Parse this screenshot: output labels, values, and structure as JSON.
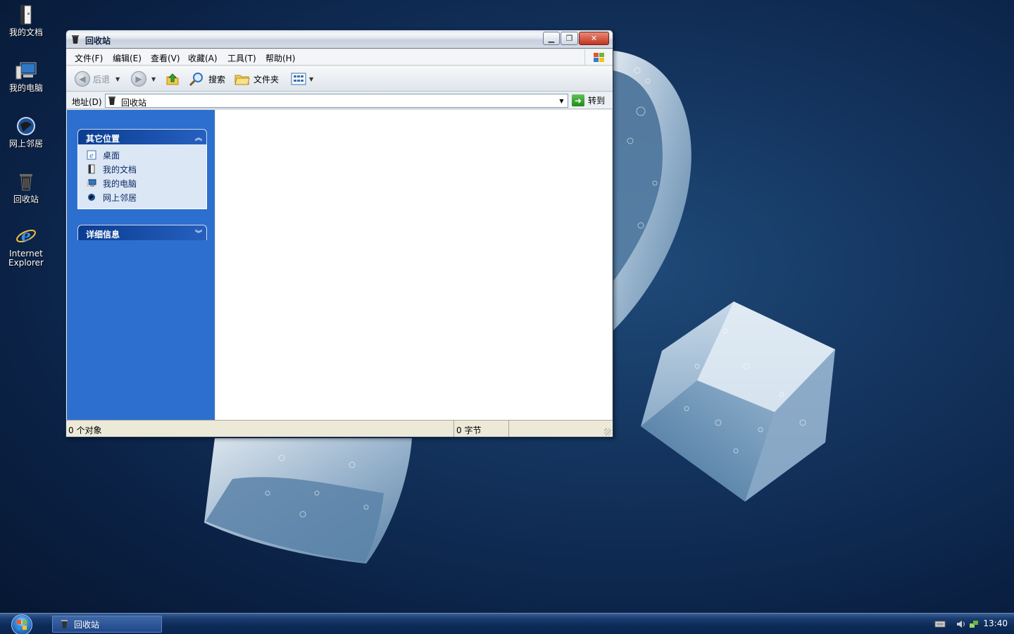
{
  "desktop": {
    "icons": [
      {
        "label": "我的文档",
        "icon": "my-documents-icon"
      },
      {
        "label": "我的电脑",
        "icon": "my-computer-icon"
      },
      {
        "label": "网上邻居",
        "icon": "network-places-icon"
      },
      {
        "label": "回收站",
        "icon": "recycle-bin-icon"
      },
      {
        "label_line1": "Internet",
        "label_line2": "Explorer",
        "icon": "internet-explorer-icon"
      }
    ]
  },
  "window": {
    "title": "回收站",
    "menu": [
      "文件(F)",
      "编辑(E)",
      "查看(V)",
      "收藏(A)",
      "工具(T)",
      "帮助(H)"
    ],
    "toolbar": {
      "back_label": "后退",
      "search_label": "搜索",
      "folders_label": "文件夹"
    },
    "address": {
      "label": "地址(D)",
      "value": "回收站",
      "go_label": "转到"
    },
    "panels": [
      {
        "title": "其它位置",
        "items": [
          {
            "label": "桌面",
            "icon": "desktop-icon"
          },
          {
            "label": "我的文档",
            "icon": "my-documents-icon"
          },
          {
            "label": "我的电脑",
            "icon": "my-computer-icon"
          },
          {
            "label": "网上邻居",
            "icon": "network-places-icon"
          }
        ]
      },
      {
        "title": "详细信息",
        "items": []
      }
    ],
    "status": {
      "objects": "0 个对象",
      "size": "0 字节"
    }
  },
  "taskbar": {
    "task_label": "回收站",
    "clock": "13:40"
  },
  "colors": {
    "desktop_bg": "#0b2246",
    "left_pane": "#2d6fcf",
    "panel_header": "#0b3c91",
    "taskbar": "#0d2a57"
  }
}
